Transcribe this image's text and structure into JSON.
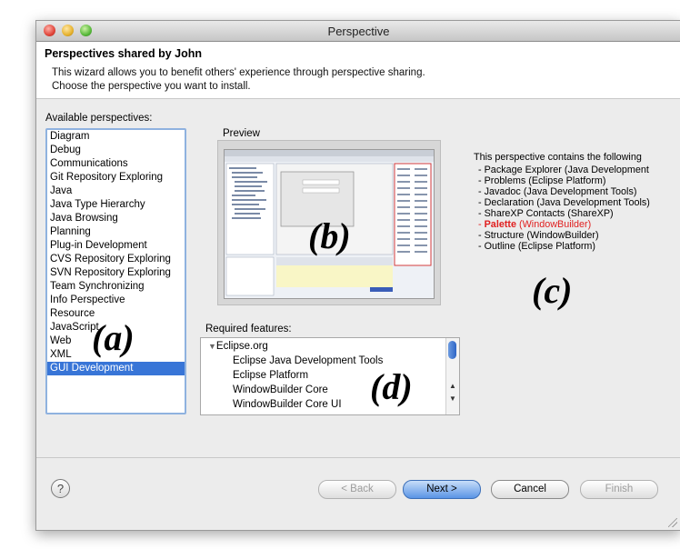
{
  "window": {
    "title": "Perspective"
  },
  "header": {
    "title": "Perspectives shared by John",
    "line1": "This wizard allows you to benefit others' experience through perspective sharing.",
    "line2": "Choose the perspective you want to install."
  },
  "perspectives": {
    "label": "Available perspectives:",
    "items": [
      "Diagram",
      "Debug",
      "Communications",
      "Git Repository Exploring",
      "Java",
      "Java Type Hierarchy",
      "Java Browsing",
      "Planning",
      "Plug-in Development",
      "CVS Repository Exploring",
      "SVN Repository Exploring",
      "Team Synchronizing",
      "Info Perspective",
      "Resource",
      "JavaScript",
      "Web",
      "XML",
      "GUI Development"
    ],
    "selected": "GUI Development"
  },
  "preview": {
    "label": "Preview"
  },
  "contents": {
    "intro": "This perspective contains the following",
    "items": [
      {
        "name": "Package Explorer",
        "source": "(Java Development"
      },
      {
        "name": "Problems",
        "source": "(Eclipse Platform)"
      },
      {
        "name": "Javadoc",
        "source": "(Java Development Tools)"
      },
      {
        "name": "Declaration",
        "source": "(Java Development Tools)"
      },
      {
        "name": "ShareXP Contacts",
        "source": "(ShareXP)"
      },
      {
        "name": "Palette",
        "source": "(WindowBuilder)"
      },
      {
        "name": "Structure",
        "source": "(WindowBuilder)"
      },
      {
        "name": "Outline",
        "source": "(Eclipse Platform)"
      }
    ]
  },
  "features": {
    "label": "Required features:",
    "root": "Eclipse.org",
    "items": [
      "Eclipse Java Development Tools",
      "Eclipse Platform",
      "WindowBuilder Core",
      "WindowBuilder Core UI"
    ]
  },
  "annotations": {
    "a": "(a)",
    "b": "(b)",
    "c": "(c)",
    "d": "(d)"
  },
  "buttons": {
    "help": "?",
    "back": "< Back",
    "next": "Next >",
    "cancel": "Cancel",
    "finish": "Finish"
  },
  "icons": {
    "tree_toggle": "triangle-down-icon",
    "scroll_up": "arrow-up-icon",
    "scroll_down": "arrow-down-icon",
    "help": "help-icon"
  },
  "colors": {
    "selection": "#3875d7",
    "highlight_text": "#e02020",
    "default_button": "#5a94e6"
  }
}
